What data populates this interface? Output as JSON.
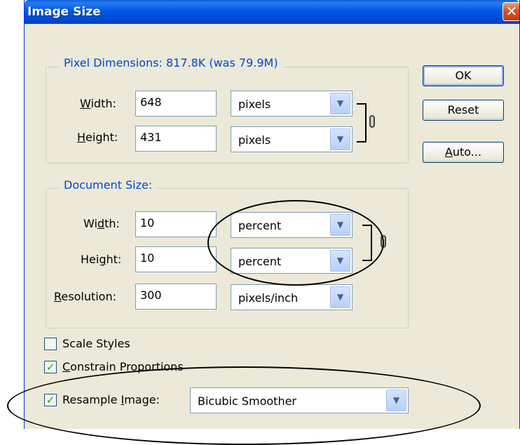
{
  "window": {
    "title": "Image Size",
    "close_glyph": "✕"
  },
  "pixel_dimensions": {
    "legend": "Pixel Dimensions:  817.8K (was 79.9M)",
    "width_label": "Width:",
    "width_value": "648",
    "width_unit": "pixels",
    "height_label": "Height:",
    "height_value": "431",
    "height_unit": "pixels"
  },
  "document_size": {
    "legend": "Document Size:",
    "width_label": "Width:",
    "width_value": "10",
    "width_unit": "percent",
    "height_label": "Height:",
    "height_value": "10",
    "height_unit": "percent",
    "resolution_label": "Resolution:",
    "resolution_value": "300",
    "resolution_unit": "pixels/inch"
  },
  "buttons": {
    "ok": "OK",
    "reset": "Reset",
    "auto": "Auto..."
  },
  "options": {
    "scale_styles": {
      "label": "Scale Styles",
      "checked": false
    },
    "constrain": {
      "label": "Constrain Proportions",
      "checked": true
    },
    "resample": {
      "label": "Resample Image:",
      "checked": true,
      "method": "Bicubic Smoother"
    }
  },
  "icons": {
    "dropdown": "chevron-down-icon",
    "link": "link-icon",
    "check": "checkmark-icon"
  },
  "colors": {
    "title_bar": "#0058e6",
    "legend_text": "#0046d5",
    "dialog_bg": "#ece9d8",
    "close": "#d8522e"
  }
}
